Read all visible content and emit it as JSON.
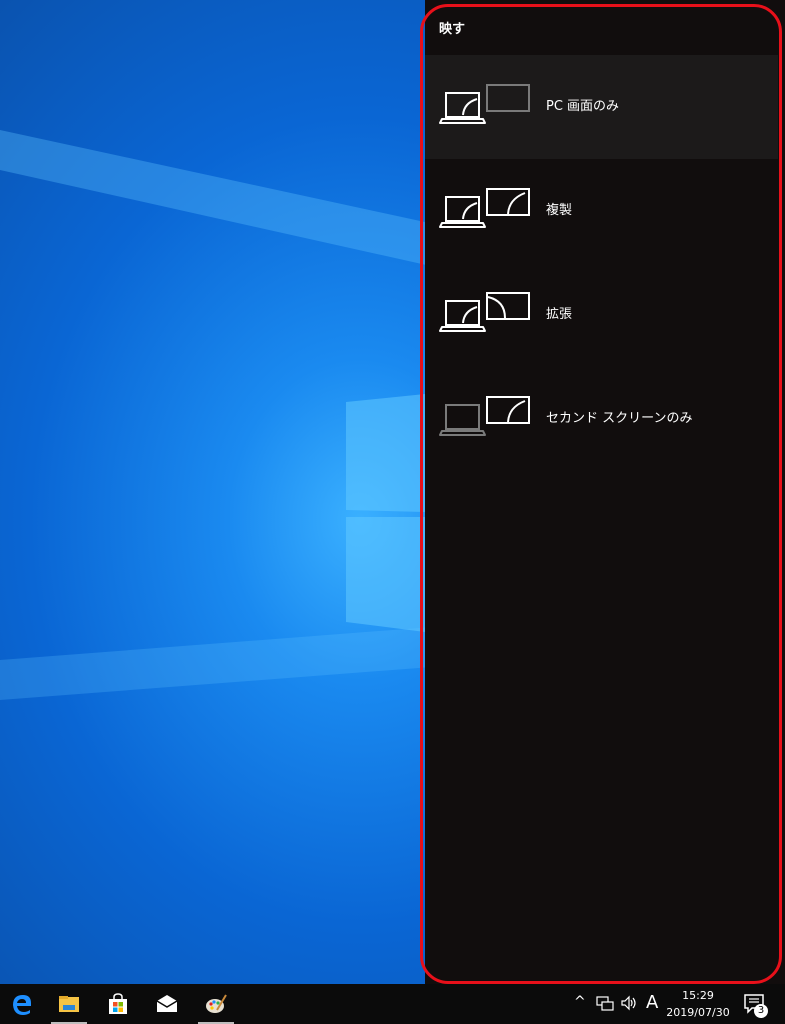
{
  "project_panel": {
    "title": "映す",
    "options": [
      {
        "label": "PC 画面のみ",
        "icon": "pc-screen-only-icon",
        "selected": true
      },
      {
        "label": "複製",
        "icon": "duplicate-icon",
        "selected": false
      },
      {
        "label": "拡張",
        "icon": "extend-icon",
        "selected": false
      },
      {
        "label": "セカンド スクリーンのみ",
        "icon": "second-screen-only-icon",
        "selected": false
      }
    ]
  },
  "taskbar": {
    "apps": [
      "edge-icon",
      "file-explorer-icon",
      "store-icon",
      "mail-icon",
      "paint-icon"
    ],
    "tray": {
      "ime": "A",
      "time": "15:29",
      "date": "2019/07/30",
      "notifications_count": "3"
    }
  },
  "colors": {
    "highlight": "#e8101a",
    "panel_bg": "#110d0d",
    "selected_bg": "#1c1a1a"
  }
}
